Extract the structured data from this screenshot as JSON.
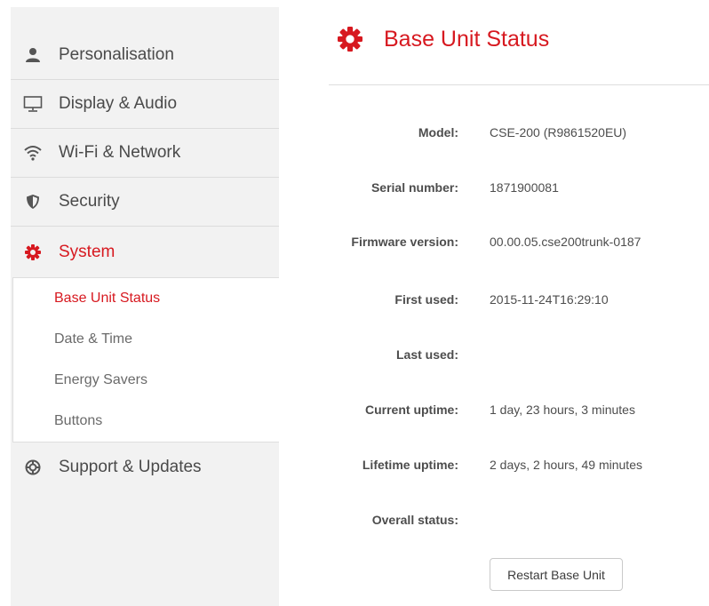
{
  "sidebar": {
    "items": [
      {
        "label": "Personalisation",
        "icon": "person-icon"
      },
      {
        "label": "Display & Audio",
        "icon": "monitor-icon"
      },
      {
        "label": "Wi-Fi & Network",
        "icon": "wifi-icon"
      },
      {
        "label": "Security",
        "icon": "shield-icon"
      },
      {
        "label": "System",
        "icon": "gear-icon",
        "active": true
      },
      {
        "label": "Support & Updates",
        "icon": "lifebuoy-icon"
      }
    ],
    "submenu": [
      {
        "label": "Base Unit Status",
        "active": true
      },
      {
        "label": "Date & Time"
      },
      {
        "label": "Energy Savers"
      },
      {
        "label": "Buttons"
      }
    ]
  },
  "main": {
    "title": "Base Unit Status",
    "title_icon": "gear-icon",
    "fields": [
      {
        "label": "Model:",
        "value": "CSE-200 (R9861520EU)"
      },
      {
        "label": "Serial number:",
        "value": "1871900081"
      },
      {
        "label": "Firmware version:",
        "value": "00.00.05.cse200trunk-0187"
      },
      {
        "label": "First used:",
        "value": "2015-11-24T16:29:10"
      },
      {
        "label": "Last used:",
        "value": ""
      },
      {
        "label": "Current uptime:",
        "value": "1 day, 23 hours, 3 minutes"
      },
      {
        "label": "Lifetime uptime:",
        "value": "2 days, 2 hours, 49 minutes"
      },
      {
        "label": "Overall status:",
        "value": ""
      }
    ],
    "restart_label": "Restart Base Unit"
  },
  "colors": {
    "accent": "#d71920",
    "sidebar_bg": "#f2f2f2"
  }
}
